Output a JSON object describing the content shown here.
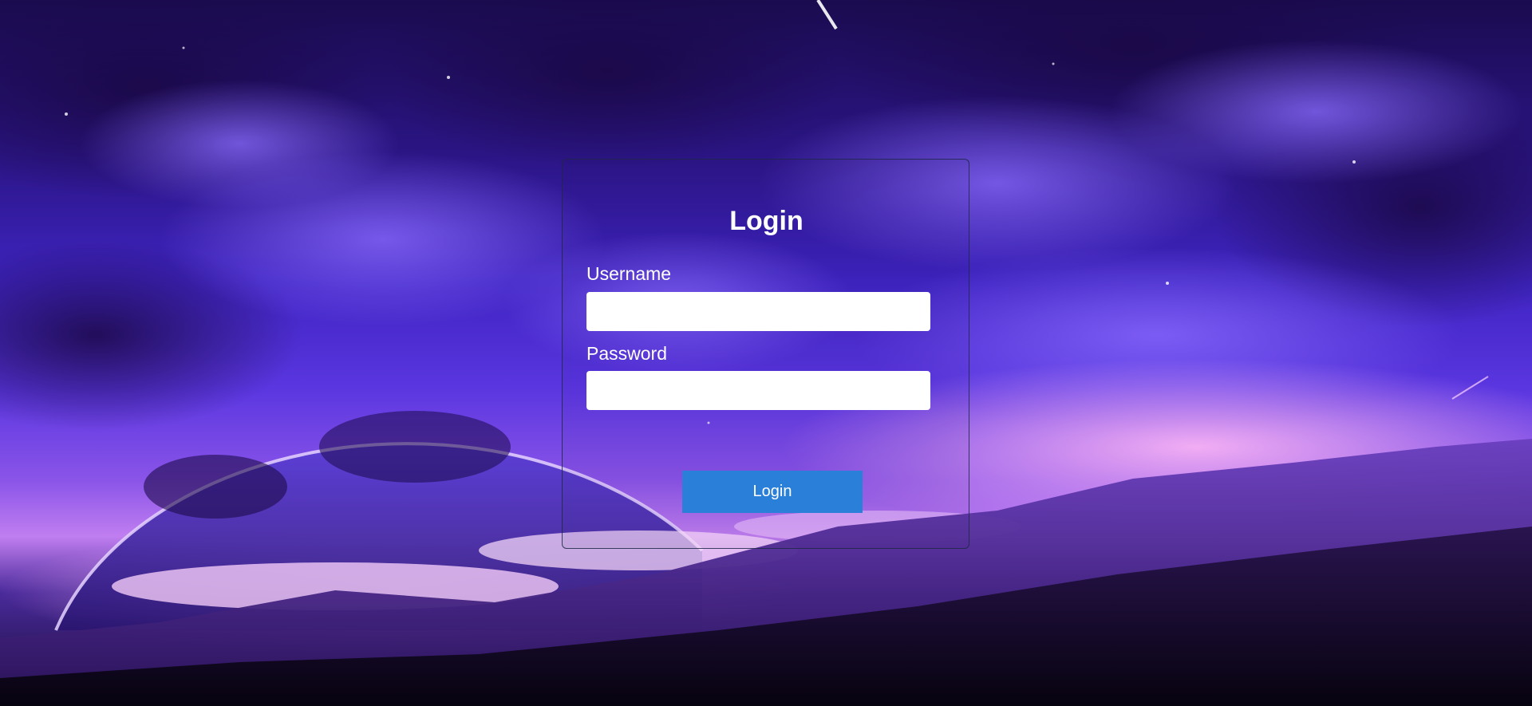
{
  "login": {
    "title": "Login",
    "username_label": "Username",
    "username_value": "",
    "password_label": "Password",
    "password_value": "",
    "submit_label": "Login"
  },
  "colors": {
    "button_bg": "#2a7fd9",
    "text": "#ffffff",
    "input_bg": "#ffffff"
  }
}
